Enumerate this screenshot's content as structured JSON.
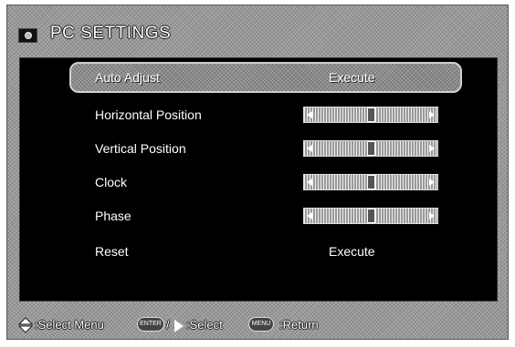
{
  "window": {
    "title": "PC SETTINGS",
    "icon": "monitor-icon"
  },
  "menu": {
    "items": [
      {
        "label": "Auto Adjust",
        "value": "Execute",
        "selected": true
      },
      {
        "label": "Horizontal Position",
        "slider": 0.5
      },
      {
        "label": "Vertical Position",
        "slider": 0.5
      },
      {
        "label": "Clock",
        "slider": 0.5
      },
      {
        "label": "Phase",
        "slider": 0.5
      },
      {
        "label": "Reset",
        "value": "Execute",
        "selected": false
      }
    ]
  },
  "footer": {
    "select_menu_label": ":Select Menu",
    "enter_key": "ENTER",
    "select_label": ":Select",
    "menu_key": "MENU",
    "return_label": ":Return"
  },
  "colors": {
    "panel": "#000000",
    "frame": "#9a9a9a",
    "text": "#ffffff"
  }
}
